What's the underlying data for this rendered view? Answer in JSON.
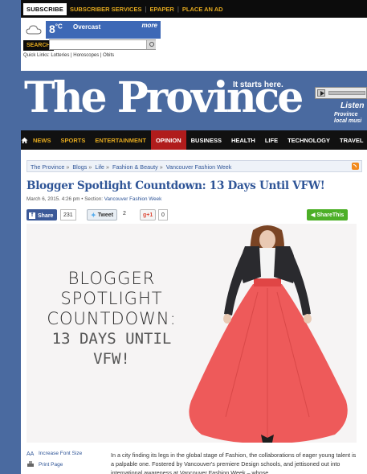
{
  "topbar": {
    "subscribe": "SUBSCRIBE",
    "links": [
      "SUBSCRIBER SERVICES",
      "EPAPER",
      "PLACE AN AD"
    ]
  },
  "weather": {
    "temp": "8",
    "unit": "°C",
    "condition": "Overcast",
    "more": "more"
  },
  "search": {
    "label": "SEARCH",
    "placeholder": ""
  },
  "quick_links": "Quick Links:  Lotteries | Horoscopes | Obits",
  "masthead": {
    "logo": "The Province",
    "tagline": "It starts here.",
    "promo_title": "Listen",
    "promo_line1": "Province",
    "promo_line2": "local musi"
  },
  "nav": {
    "items": [
      "NEWS",
      "SPORTS",
      "ENTERTAINMENT",
      "OPINION",
      "BUSINESS",
      "HEALTH",
      "LIFE",
      "TECHNOLOGY",
      "TRAVEL"
    ],
    "active": "OPINION"
  },
  "breadcrumb": [
    "The Province",
    "Blogs",
    "Life",
    "Fashion & Beauty",
    "Vancouver Fashion Week"
  ],
  "article": {
    "headline": "Blogger Spotlight Countdown: 13 Days Until VFW!",
    "date": "March 6, 2015. 4:26 pm • Section:",
    "section": "Vancouver Fashion Week",
    "hero_line1": "BLOGGER",
    "hero_line2": "SPOTLIGHT",
    "hero_line3": "COUNTDOWN:",
    "hero_line4": "13 DAYS UNTIL",
    "hero_line5": "VFW!",
    "body": "In a city finding its legs in the global stage of Fashion, the collaborations of eager young talent is a palpable one. Fostered by Vancouver's premiere Design schools, and jettisoned out into international awareness at Vancouver Fashion Week – whose"
  },
  "share": {
    "fb_label": "Share",
    "fb_count": "231",
    "tw_label": "Tweet",
    "tw_count": "2",
    "gp_label": "g+1",
    "gp_count": "0",
    "sharethis": "ShareThis"
  },
  "tools": {
    "font_size": "Increase Font Size",
    "print": "Print Page"
  }
}
